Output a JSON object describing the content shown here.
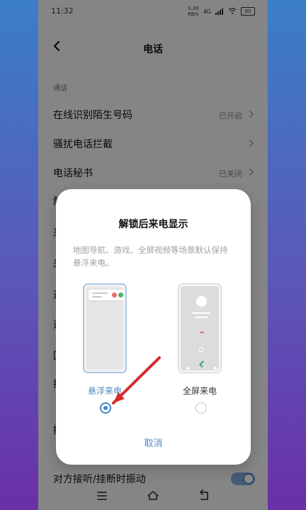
{
  "status_bar": {
    "time": "11:32",
    "network_speed": "0.30",
    "network_unit": "KB/s",
    "signal": "4G",
    "battery": "80"
  },
  "header": {
    "title": "电话"
  },
  "settings": {
    "section_label": "通话",
    "items": [
      {
        "label": "在线识别陌生号码",
        "value": "已开启"
      },
      {
        "label": "骚扰电话拦截",
        "value": ""
      },
      {
        "label": "电话秘书",
        "value": "已关闭"
      }
    ],
    "hidden_partial_labels": [
      "解",
      "来",
      "来",
      "通",
      "通",
      "回",
      "接",
      "接"
    ],
    "vibration_label": "对方接听/挂断时振动"
  },
  "dialog": {
    "title": "解锁后来电显示",
    "description": "地图导航、游戏、全屏视频等场景默认保持悬浮来电。",
    "options": [
      {
        "label": "悬浮来电",
        "selected": true
      },
      {
        "label": "全屏来电",
        "selected": false
      }
    ],
    "cancel_label": "取消"
  },
  "colors": {
    "accent": "#4a89c7",
    "dialog_bg": "#ffffff",
    "overlay": "rgba(0,0,0,0.46)"
  }
}
